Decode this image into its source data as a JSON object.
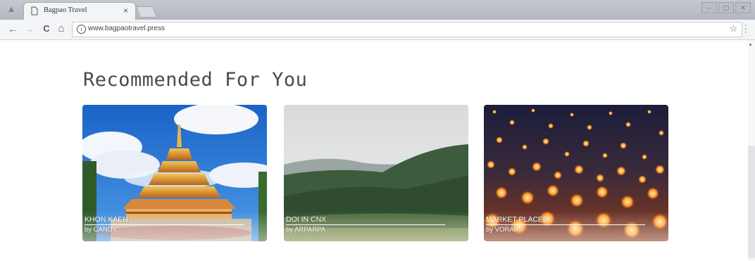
{
  "browser": {
    "tab": {
      "title": "Bagpao Travel",
      "close_glyph": "×"
    },
    "toolbar": {
      "back_glyph": "←",
      "forward_glyph": "→",
      "reload_glyph": "C",
      "home_glyph": "⌂",
      "info_glyph": "i",
      "url": "www.bagpaotravel.press",
      "star_glyph": "☆"
    },
    "window_controls": [
      "–",
      "▢",
      "✕"
    ]
  },
  "page": {
    "heading": "Recommended For You",
    "cards": [
      {
        "title": "Khon Kaen",
        "author": "by CANDY",
        "image": "golden-pagoda-under-blue-sky"
      },
      {
        "title": "DOI IN CNX",
        "author": "by ARPARPA",
        "image": "misty-mountain-valley"
      },
      {
        "title": "MARKET PLACEE",
        "author": "by VORAP",
        "image": "floating-sky-lanterns-night"
      }
    ]
  },
  "colors": {
    "heading": "#4a4a4a",
    "chrome": "#c4c8cf",
    "card_text": "#ffffff"
  }
}
